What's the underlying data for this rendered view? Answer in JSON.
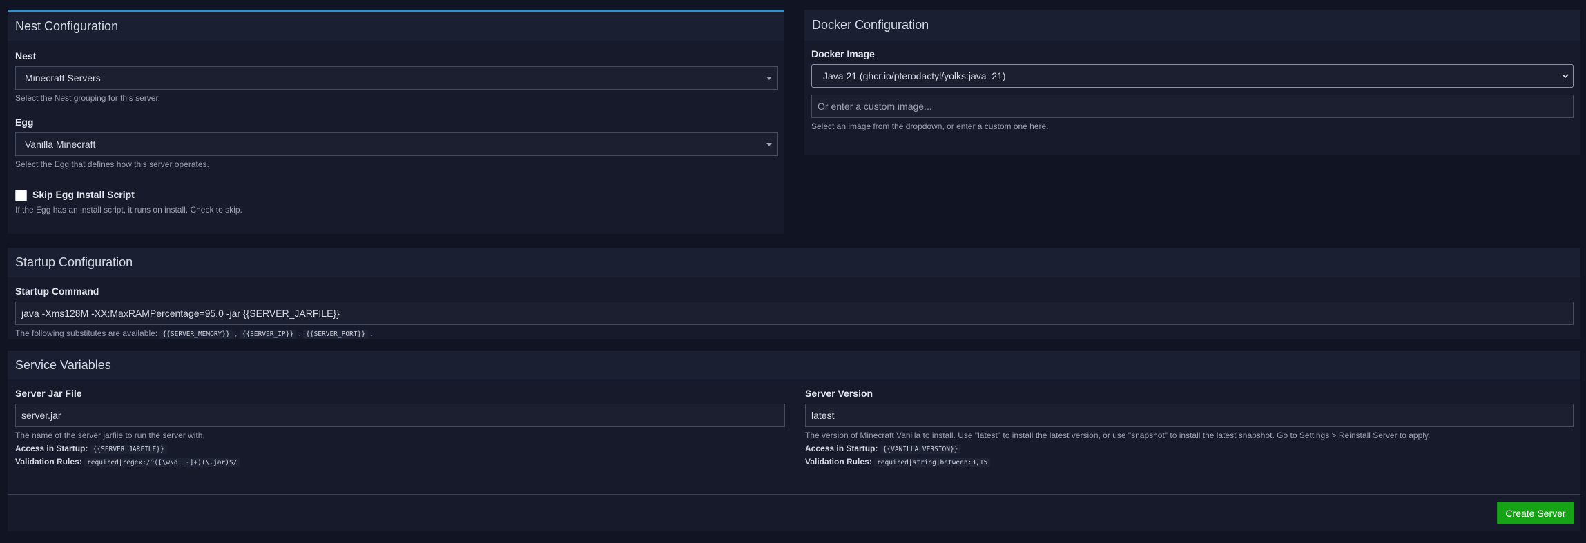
{
  "nest_config": {
    "title": "Nest Configuration",
    "nest": {
      "label": "Nest",
      "value": "Minecraft Servers",
      "help": "Select the Nest grouping for this server."
    },
    "egg": {
      "label": "Egg",
      "value": "Vanilla Minecraft",
      "help": "Select the Egg that defines how this server operates."
    },
    "skip_script": {
      "label": "Skip Egg Install Script",
      "checked": false,
      "help": "If the Egg has an install script, it runs on install. Check to skip."
    }
  },
  "docker_config": {
    "title": "Docker Configuration",
    "image_label": "Docker Image",
    "image_value": "Java 21 (ghcr.io/pterodactyl/yolks:java_21)",
    "custom_placeholder": "Or enter a custom image...",
    "help": "Select an image from the dropdown, or enter a custom one here."
  },
  "startup_config": {
    "title": "Startup Configuration",
    "command_label": "Startup Command",
    "command_value": "java -Xms128M -XX:MaxRAMPercentage=95.0 -jar {{SERVER_JARFILE}}",
    "help_prefix": "The following substitutes are available:",
    "substitutes": [
      "{{SERVER_MEMORY}}",
      "{{SERVER_IP}}",
      "{{SERVER_PORT}}"
    ],
    "sep": ",",
    "end": "."
  },
  "service_variables": {
    "title": "Service Variables",
    "access_label": "Access in Startup:",
    "validation_label": "Validation Rules:",
    "variables": [
      {
        "label": "Server Jar File",
        "value": "server.jar",
        "description": "The name of the server jarfile to run the server with.",
        "env": "{{SERVER_JARFILE}}",
        "rules": "required|regex:/^([\\w\\d._-]+)(\\.jar)$/"
      },
      {
        "label": "Server Version",
        "value": "latest",
        "description": "The version of Minecraft Vanilla to install. Use \"latest\" to install the latest version, or use \"snapshot\" to install the latest snapshot. Go to Settings > Reinstall Server to apply.",
        "env": "{{VANILLA_VERSION}}",
        "rules": "required|string|between:3,15"
      }
    ],
    "submit_label": "Create Server"
  },
  "colors": {
    "accent_top": "#3c8dbc",
    "create_button": "#16a316"
  },
  "icons": {
    "select_caret": "caret-down-icon",
    "native_chevron": "chevron-down-icon"
  }
}
